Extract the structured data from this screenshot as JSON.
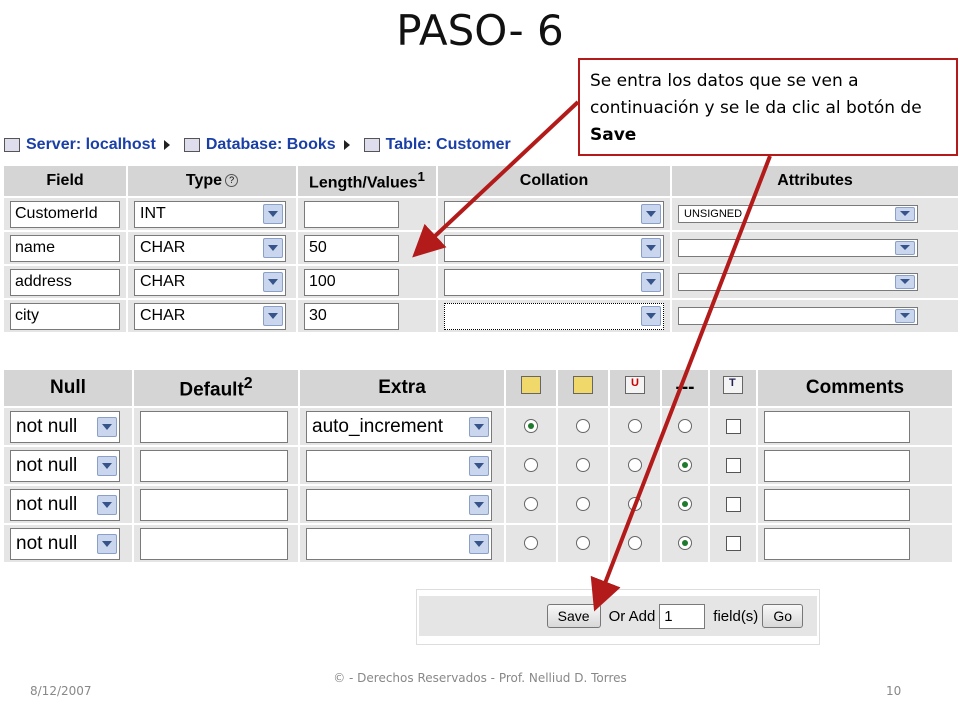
{
  "slide": {
    "title": "PASO- 6"
  },
  "breadcrumb": {
    "server": "Server: localhost",
    "database": "Database: Books",
    "table": "Table: Customer"
  },
  "callout": {
    "text_before": "Se entra los datos que se ven a continuación y se le da clic al botón de ",
    "text_bold": "Save"
  },
  "fields_table": {
    "headers": {
      "field": "Field",
      "type": "Type",
      "length": "Length/Values",
      "length_sup": "1",
      "collation": "Collation",
      "attributes": "Attributes"
    },
    "rows": [
      {
        "field": "CustomerId",
        "type": "INT",
        "length": "",
        "collation": "",
        "attributes": "UNSIGNED"
      },
      {
        "field": "name",
        "type": "CHAR",
        "length": "50",
        "collation": "",
        "attributes": ""
      },
      {
        "field": "address",
        "type": "CHAR",
        "length": "100",
        "collation": "",
        "attributes": ""
      },
      {
        "field": "city",
        "type": "CHAR",
        "length": "30",
        "collation": "",
        "attributes": ""
      }
    ]
  },
  "options_table": {
    "headers": {
      "null": "Null",
      "default": "Default",
      "default_sup": "2",
      "extra": "Extra",
      "none": "---",
      "comments": "Comments"
    },
    "rows": [
      {
        "null": "not null",
        "default": "",
        "extra": "auto_increment",
        "index": "primary",
        "fulltext": false,
        "comments": ""
      },
      {
        "null": "not null",
        "default": "",
        "extra": "",
        "index": "none",
        "fulltext": false,
        "comments": ""
      },
      {
        "null": "not null",
        "default": "",
        "extra": "",
        "index": "none",
        "fulltext": false,
        "comments": ""
      },
      {
        "null": "not null",
        "default": "",
        "extra": "",
        "index": "none",
        "fulltext": false,
        "comments": ""
      }
    ]
  },
  "save_bar": {
    "save_label": "Save",
    "or_add": "Or Add",
    "add_count": "1",
    "fields_label": "field(s)",
    "go_label": "Go"
  },
  "footer": {
    "date": "8/12/2007",
    "copyright": "© - Derechos Reservados  - Prof. Nelliud D. Torres",
    "page": "10"
  },
  "colors": {
    "arrow": "#b31b1b",
    "link": "#1a3fa6",
    "header_bg": "#d5d5d5",
    "cell_bg": "#e5e5e5"
  }
}
